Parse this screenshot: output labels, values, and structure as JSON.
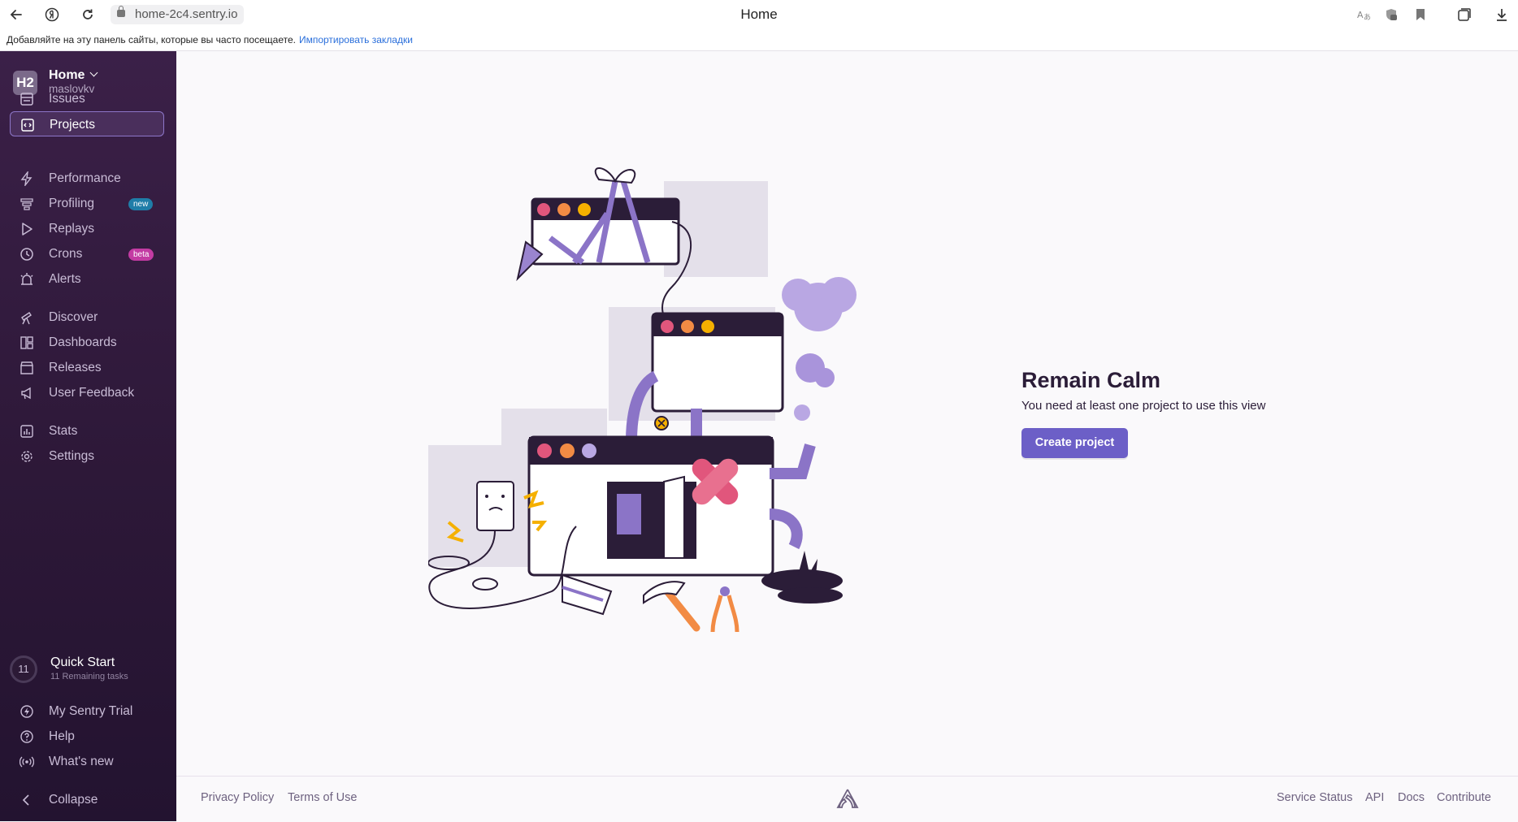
{
  "browser": {
    "url": "home-2c4.sentry.io",
    "tab_title": "Home",
    "bookmark_bar": {
      "message": "Добавляйте на эту панель сайты, которые вы часто посещаете.",
      "link": "Импортировать закладки"
    }
  },
  "sidebar": {
    "org": {
      "avatar": "H2",
      "name": "Home",
      "user": "maslovkv"
    },
    "items": [
      {
        "label": "Issues",
        "icon": "issues-icon"
      },
      {
        "label": "Projects",
        "icon": "projects-icon",
        "active": true
      },
      {
        "label": "Performance",
        "icon": "lightning-icon"
      },
      {
        "label": "Profiling",
        "icon": "profiling-icon",
        "badge": "new"
      },
      {
        "label": "Replays",
        "icon": "play-icon"
      },
      {
        "label": "Crons",
        "icon": "timer-icon",
        "badge": "beta"
      },
      {
        "label": "Alerts",
        "icon": "siren-icon"
      },
      {
        "label": "Discover",
        "icon": "telescope-icon"
      },
      {
        "label": "Dashboards",
        "icon": "dashboard-icon"
      },
      {
        "label": "Releases",
        "icon": "package-icon"
      },
      {
        "label": "User Feedback",
        "icon": "megaphone-icon"
      },
      {
        "label": "Stats",
        "icon": "stats-icon"
      },
      {
        "label": "Settings",
        "icon": "gear-icon"
      }
    ],
    "quick_start": {
      "count": "11",
      "title": "Quick Start",
      "subtitle": "11 Remaining tasks"
    },
    "bottom": [
      {
        "label": "My Sentry Trial",
        "icon": "lightning-circle-icon"
      },
      {
        "label": "Help",
        "icon": "help-icon"
      },
      {
        "label": "What's new",
        "icon": "broadcast-icon"
      }
    ],
    "collapse": "Collapse"
  },
  "main": {
    "title": "Remain Calm",
    "subtitle": "You need at least one project to use this view",
    "button": "Create project"
  },
  "footer": {
    "left": [
      "Privacy Policy",
      "Terms of Use"
    ],
    "right": [
      "Service Status",
      "API",
      "Docs",
      "Contribute"
    ]
  },
  "colors": {
    "sidebar_top": "#3b2048",
    "sidebar_bottom": "#231330",
    "accent": "#6c5fc7",
    "badge_new": "#1f7da8",
    "badge_beta": "#c33ba3"
  }
}
